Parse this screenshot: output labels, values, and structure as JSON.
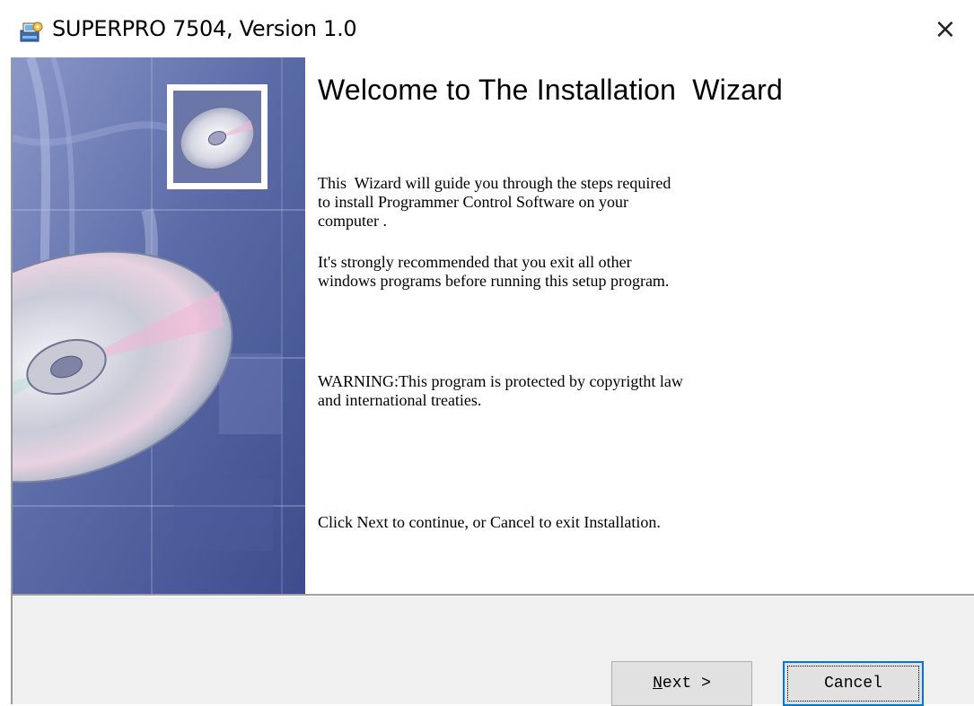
{
  "window": {
    "title": "SUPERPRO 7504, Version 1.0",
    "close_label": "×"
  },
  "wizard": {
    "heading": "Welcome to The Installation  Wizard",
    "paragraphs": [
      "This  Wizard will guide you through the steps required\nto install Programmer Control Software on your\ncomputer .",
      "It's strongly recommended that you exit all other\nwindows programs before running this setup program.",
      "WARNING:This program is protected by copyrigtht law\nand international treaties.",
      "Click Next to continue, or Cancel to exit Installation."
    ]
  },
  "buttons": {
    "next_mnemonic": "N",
    "next_rest": "ext >",
    "cancel_label": "Cancel"
  },
  "colors": {
    "accent": "#0078d7",
    "footer_bg": "#f0f0f0",
    "image_base": "#5e6fa8"
  }
}
